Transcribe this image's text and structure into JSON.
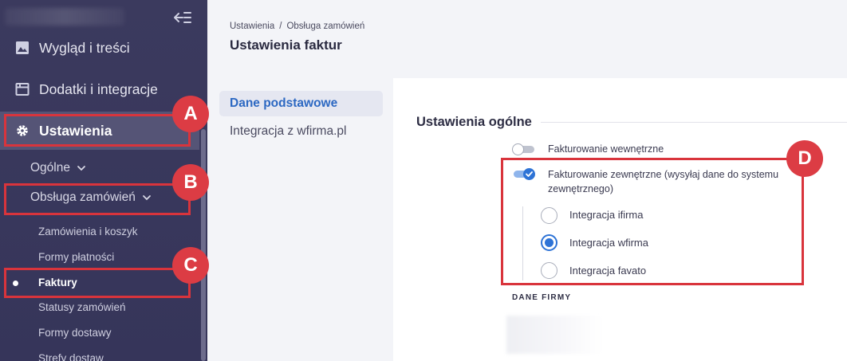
{
  "sidebar": {
    "main_items": [
      {
        "label": "Wygląd i treści",
        "icon": "image-icon"
      },
      {
        "label": "Dodatki i integracje",
        "icon": "window-icon"
      },
      {
        "label": "Ustawienia",
        "icon": "gear-icon"
      }
    ],
    "sub_items": [
      {
        "label": "Ogólne",
        "icon": "chevron-down-icon"
      },
      {
        "label": "Obsługa zamówień",
        "icon": "chevron-down-icon"
      }
    ],
    "sub_sub_items": [
      "Zamówienia i koszyk",
      "Formy płatności",
      "Faktury",
      "Statusy zamówień",
      "Formy dostawy",
      "Strefy dostaw"
    ],
    "active_item": "Faktury"
  },
  "header": {
    "breadcrumb": [
      "Ustawienia",
      "/",
      "Obsługa zamówień"
    ],
    "title": "Ustawienia faktur"
  },
  "inner_nav": {
    "items": [
      "Dane podstawowe",
      "Integracja z wfirma.pl"
    ],
    "active": "Dane podstawowe"
  },
  "content": {
    "section_title": "Ustawienia ogólne",
    "toggles": [
      {
        "label": "Fakturowanie wewnętrzne",
        "on": false
      },
      {
        "label": "Fakturowanie zewnętrzne (wysyłaj dane do systemu zewnętrznego)",
        "on": true
      }
    ],
    "radios": [
      {
        "label": "Integracja ifirma",
        "checked": false
      },
      {
        "label": "Integracja wfirma",
        "checked": true
      },
      {
        "label": "Integracja favato",
        "checked": false
      }
    ],
    "subsection_title": "DANE FIRMY"
  },
  "callouts": [
    "A",
    "B",
    "C",
    "D"
  ],
  "colors": {
    "sidebar_bg": "#3b3a5e",
    "accent_blue": "#2e73d6",
    "callout_red": "#d9343c"
  }
}
